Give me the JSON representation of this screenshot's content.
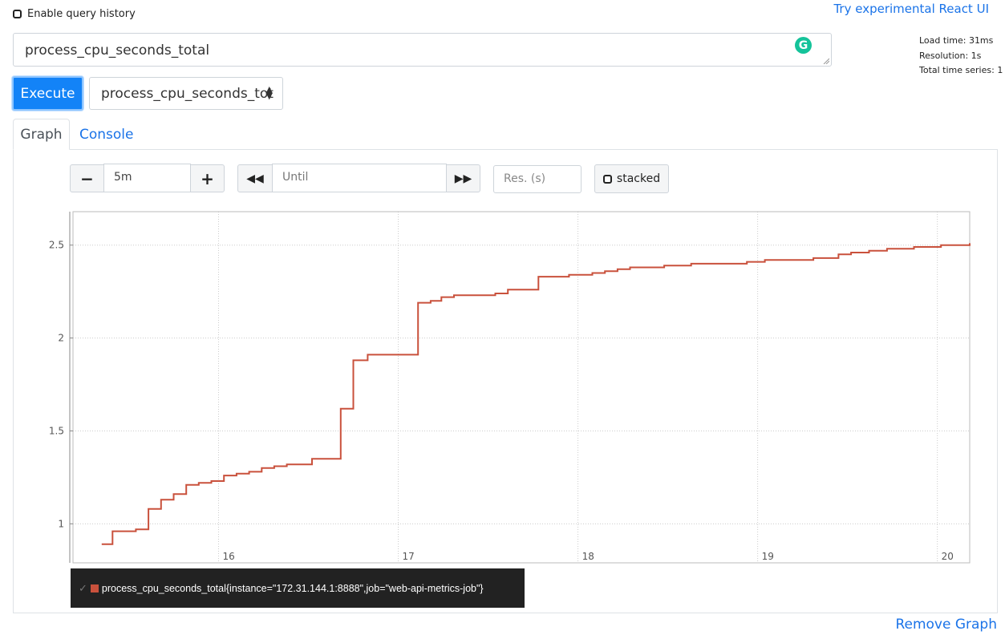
{
  "header": {
    "history_label": "Enable query history",
    "react_link": "Try experimental React UI",
    "stats": {
      "load_time": "Load time: 31ms",
      "resolution": "Resolution: 1s",
      "total_series": "Total time series: 1"
    }
  },
  "query": {
    "expression": "process_cpu_seconds_total",
    "execute_label": "Execute",
    "metric_select": "process_cpu_seconds_tot"
  },
  "tabs": {
    "graph": "Graph",
    "console": "Console"
  },
  "controls": {
    "minus": "−",
    "range": "5m",
    "plus": "+",
    "back": "◀◀",
    "until_placeholder": "Until",
    "forward": "▶▶",
    "res_placeholder": "Res. (s)",
    "stacked": "stacked"
  },
  "chart_data": {
    "type": "line",
    "y_ticks": [
      "1",
      "1.5",
      "2",
      "2.5"
    ],
    "x_ticks": [
      "16",
      "17",
      "18",
      "19",
      "20"
    ],
    "ylim": [
      0.79,
      2.68
    ],
    "xlim": [
      15.19,
      20.18
    ],
    "grid": true,
    "series": [
      {
        "name": "process_cpu_seconds_total{instance=\"172.31.144.1:8888\",job=\"web-api-metrics-job\"}",
        "color": "#c9513c",
        "step": true,
        "x": [
          15.35,
          15.41,
          15.47,
          15.54,
          15.61,
          15.68,
          15.75,
          15.82,
          15.89,
          15.96,
          16.03,
          16.1,
          16.17,
          16.24,
          16.31,
          16.38,
          16.45,
          16.52,
          16.68,
          16.75,
          16.83,
          16.91,
          17.11,
          17.18,
          17.24,
          17.31,
          17.44,
          17.54,
          17.61,
          17.78,
          17.95,
          18.08,
          18.15,
          18.22,
          18.29,
          18.36,
          18.48,
          18.63,
          18.78,
          18.94,
          19.04,
          19.16,
          19.31,
          19.38,
          19.45,
          19.52,
          19.62,
          19.72,
          19.87,
          20.02,
          20.18
        ],
        "y": [
          0.89,
          0.96,
          0.96,
          0.97,
          1.08,
          1.13,
          1.16,
          1.21,
          1.22,
          1.23,
          1.26,
          1.27,
          1.28,
          1.3,
          1.31,
          1.32,
          1.32,
          1.35,
          1.62,
          1.88,
          1.91,
          1.91,
          2.19,
          2.2,
          2.22,
          2.23,
          2.23,
          2.24,
          2.26,
          2.33,
          2.34,
          2.35,
          2.36,
          2.37,
          2.38,
          2.38,
          2.39,
          2.4,
          2.4,
          2.41,
          2.42,
          2.42,
          2.43,
          2.43,
          2.45,
          2.46,
          2.47,
          2.48,
          2.49,
          2.5,
          2.51
        ]
      }
    ]
  },
  "legend": {
    "check": "✓",
    "label": "process_cpu_seconds_total{instance=\"172.31.144.1:8888\",job=\"web-api-metrics-job\"}",
    "color": "#c9513c"
  },
  "footer": {
    "remove_graph": "Remove Graph"
  }
}
